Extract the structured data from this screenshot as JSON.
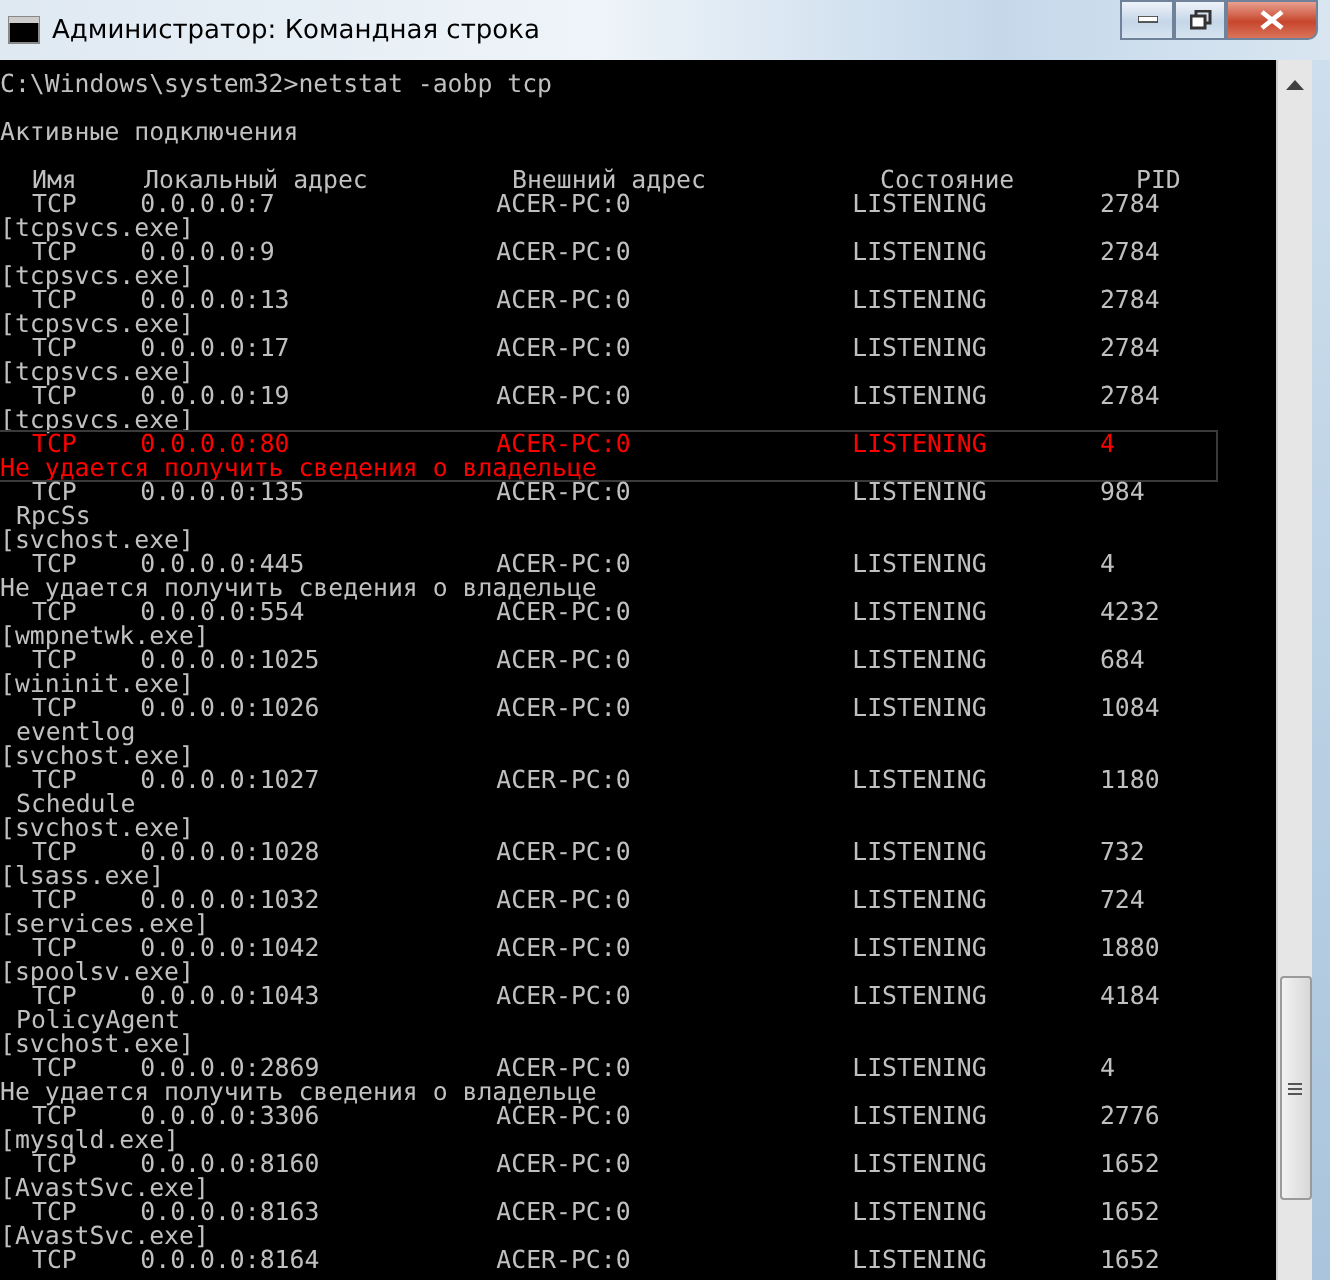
{
  "window": {
    "title": "Администратор: Командная строка"
  },
  "console": {
    "command": "C:\\Windows\\system32>netstat -aobp tcp",
    "heading": "Активные подключения",
    "columns": [
      "Имя",
      "Локальный адрес",
      "Внешний адрес",
      "Состояние",
      "PID"
    ],
    "connections": [
      {
        "proto": "TCP",
        "local": "0.0.0.0:7",
        "foreign": "ACER-PC:0",
        "state": "LISTENING",
        "pid": "2784",
        "highlighted": false,
        "owner": [
          {
            "kind": "process",
            "text": "[tcpsvcs.exe]"
          }
        ]
      },
      {
        "proto": "TCP",
        "local": "0.0.0.0:9",
        "foreign": "ACER-PC:0",
        "state": "LISTENING",
        "pid": "2784",
        "highlighted": false,
        "owner": [
          {
            "kind": "process",
            "text": "[tcpsvcs.exe]"
          }
        ]
      },
      {
        "proto": "TCP",
        "local": "0.0.0.0:13",
        "foreign": "ACER-PC:0",
        "state": "LISTENING",
        "pid": "2784",
        "highlighted": false,
        "owner": [
          {
            "kind": "process",
            "text": "[tcpsvcs.exe]"
          }
        ]
      },
      {
        "proto": "TCP",
        "local": "0.0.0.0:17",
        "foreign": "ACER-PC:0",
        "state": "LISTENING",
        "pid": "2784",
        "highlighted": false,
        "owner": [
          {
            "kind": "process",
            "text": "[tcpsvcs.exe]"
          }
        ]
      },
      {
        "proto": "TCP",
        "local": "0.0.0.0:19",
        "foreign": "ACER-PC:0",
        "state": "LISTENING",
        "pid": "2784",
        "highlighted": false,
        "owner": [
          {
            "kind": "process",
            "text": "[tcpsvcs.exe]"
          }
        ]
      },
      {
        "proto": "TCP",
        "local": "0.0.0.0:80",
        "foreign": "ACER-PC:0",
        "state": "LISTENING",
        "pid": "4",
        "highlighted": true,
        "owner": [
          {
            "kind": "message",
            "text": "Не удается получить сведения о владельце"
          }
        ]
      },
      {
        "proto": "TCP",
        "local": "0.0.0.0:135",
        "foreign": "ACER-PC:0",
        "state": "LISTENING",
        "pid": "984",
        "highlighted": false,
        "owner": [
          {
            "kind": "service",
            "text": "RpcSs"
          },
          {
            "kind": "process",
            "text": "[svchost.exe]"
          }
        ]
      },
      {
        "proto": "TCP",
        "local": "0.0.0.0:445",
        "foreign": "ACER-PC:0",
        "state": "LISTENING",
        "pid": "4",
        "highlighted": false,
        "owner": [
          {
            "kind": "message",
            "text": "Не удается получить сведения о владельце"
          }
        ]
      },
      {
        "proto": "TCP",
        "local": "0.0.0.0:554",
        "foreign": "ACER-PC:0",
        "state": "LISTENING",
        "pid": "4232",
        "highlighted": false,
        "owner": [
          {
            "kind": "process",
            "text": "[wmpnetwk.exe]"
          }
        ]
      },
      {
        "proto": "TCP",
        "local": "0.0.0.0:1025",
        "foreign": "ACER-PC:0",
        "state": "LISTENING",
        "pid": "684",
        "highlighted": false,
        "owner": [
          {
            "kind": "process",
            "text": "[wininit.exe]"
          }
        ]
      },
      {
        "proto": "TCP",
        "local": "0.0.0.0:1026",
        "foreign": "ACER-PC:0",
        "state": "LISTENING",
        "pid": "1084",
        "highlighted": false,
        "owner": [
          {
            "kind": "service",
            "text": "eventlog"
          },
          {
            "kind": "process",
            "text": "[svchost.exe]"
          }
        ]
      },
      {
        "proto": "TCP",
        "local": "0.0.0.0:1027",
        "foreign": "ACER-PC:0",
        "state": "LISTENING",
        "pid": "1180",
        "highlighted": false,
        "owner": [
          {
            "kind": "service",
            "text": "Schedule"
          },
          {
            "kind": "process",
            "text": "[svchost.exe]"
          }
        ]
      },
      {
        "proto": "TCP",
        "local": "0.0.0.0:1028",
        "foreign": "ACER-PC:0",
        "state": "LISTENING",
        "pid": "732",
        "highlighted": false,
        "owner": [
          {
            "kind": "process",
            "text": "[lsass.exe]"
          }
        ]
      },
      {
        "proto": "TCP",
        "local": "0.0.0.0:1032",
        "foreign": "ACER-PC:0",
        "state": "LISTENING",
        "pid": "724",
        "highlighted": false,
        "owner": [
          {
            "kind": "process",
            "text": "[services.exe]"
          }
        ]
      },
      {
        "proto": "TCP",
        "local": "0.0.0.0:1042",
        "foreign": "ACER-PC:0",
        "state": "LISTENING",
        "pid": "1880",
        "highlighted": false,
        "owner": [
          {
            "kind": "process",
            "text": "[spoolsv.exe]"
          }
        ]
      },
      {
        "proto": "TCP",
        "local": "0.0.0.0:1043",
        "foreign": "ACER-PC:0",
        "state": "LISTENING",
        "pid": "4184",
        "highlighted": false,
        "owner": [
          {
            "kind": "service",
            "text": "PolicyAgent"
          },
          {
            "kind": "process",
            "text": "[svchost.exe]"
          }
        ]
      },
      {
        "proto": "TCP",
        "local": "0.0.0.0:2869",
        "foreign": "ACER-PC:0",
        "state": "LISTENING",
        "pid": "4",
        "highlighted": false,
        "owner": [
          {
            "kind": "message",
            "text": "Не удается получить сведения о владельце"
          }
        ]
      },
      {
        "proto": "TCP",
        "local": "0.0.0.0:3306",
        "foreign": "ACER-PC:0",
        "state": "LISTENING",
        "pid": "2776",
        "highlighted": false,
        "owner": [
          {
            "kind": "process",
            "text": "[mysqld.exe]"
          }
        ]
      },
      {
        "proto": "TCP",
        "local": "0.0.0.0:8160",
        "foreign": "ACER-PC:0",
        "state": "LISTENING",
        "pid": "1652",
        "highlighted": false,
        "owner": [
          {
            "kind": "process",
            "text": "[AvastSvc.exe]"
          }
        ]
      },
      {
        "proto": "TCP",
        "local": "0.0.0.0:8163",
        "foreign": "ACER-PC:0",
        "state": "LISTENING",
        "pid": "1652",
        "highlighted": false,
        "owner": [
          {
            "kind": "process",
            "text": "[AvastSvc.exe]"
          }
        ]
      },
      {
        "proto": "TCP",
        "local": "0.0.0.0:8164",
        "foreign": "ACER-PC:0",
        "state": "LISTENING",
        "pid": "1652",
        "highlighted": false
      }
    ]
  }
}
